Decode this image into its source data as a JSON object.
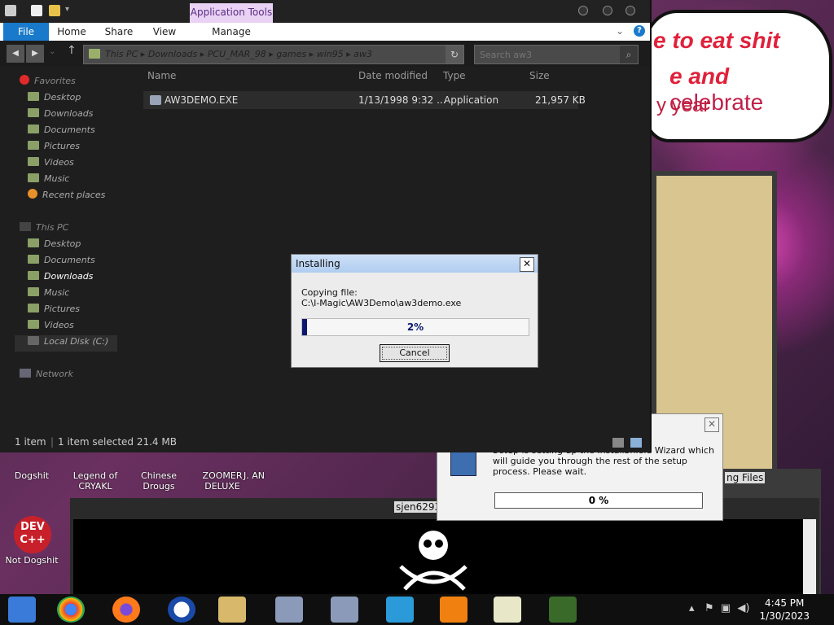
{
  "colors": {
    "accent": "#1979ca",
    "progress": "#0a1870",
    "app_tools": "#e9d2f4"
  },
  "speech": {
    "line1": "e to eat shit",
    "line2a": "e and",
    "line2b": "celebrate",
    "line3": "y year"
  },
  "explorer": {
    "context_tab": "Application Tools",
    "tabs": {
      "file": "File",
      "home": "Home",
      "share": "Share",
      "view": "View",
      "manage": "Manage"
    },
    "breadcrumb": [
      "This PC",
      "Downloads",
      "PCU_MAR_98",
      "games",
      "win95",
      "aw3"
    ],
    "search_placeholder": "Search aw3",
    "nav": {
      "favorites": "Favorites",
      "fav_items": [
        "Desktop",
        "Downloads",
        "Documents",
        "Pictures",
        "Videos",
        "Music",
        "Recent places"
      ],
      "this_pc": "This PC",
      "pc_items": [
        "Desktop",
        "Documents",
        "Downloads",
        "Music",
        "Pictures",
        "Videos",
        "Local Disk (C:)"
      ],
      "network": "Network"
    },
    "columns": {
      "name": "Name",
      "date": "Date modified",
      "type": "Type",
      "size": "Size"
    },
    "file": {
      "name": "AW3DEMO.EXE",
      "date": "1/13/1998 9:32 ...",
      "type": "Application",
      "size": "21,957 KB"
    },
    "status": {
      "count": "1 item",
      "selected": "1 item selected  21.4 MB"
    }
  },
  "installing": {
    "title": "Installing",
    "line1": "Copying file:",
    "line2": "C:\\I-Magic\\AW3Demo\\aw3demo.exe",
    "percent_label": "2%",
    "progress": 0.02,
    "cancel": "Cancel"
  },
  "installshield": {
    "text": "Setup is setting up the InstallShield Wizard which will guide you through the rest of the setup process.  Please wait.",
    "percent_label": "0 %"
  },
  "bg": {
    "files_title": "ng Files",
    "black_title": "sjen6293"
  },
  "desktop_icons": {
    "dogshit": "Dogshit",
    "legend": "Legend of CRYAKL",
    "chinese": "Chinese Drougs",
    "zoomer": "ZOOMER DELUXE",
    "partial": "J. AN",
    "dev": "DEV C++",
    "not_dogshit": "Not Dogshit"
  },
  "clock": {
    "time": "4:45 PM",
    "date": "1/30/2023"
  }
}
